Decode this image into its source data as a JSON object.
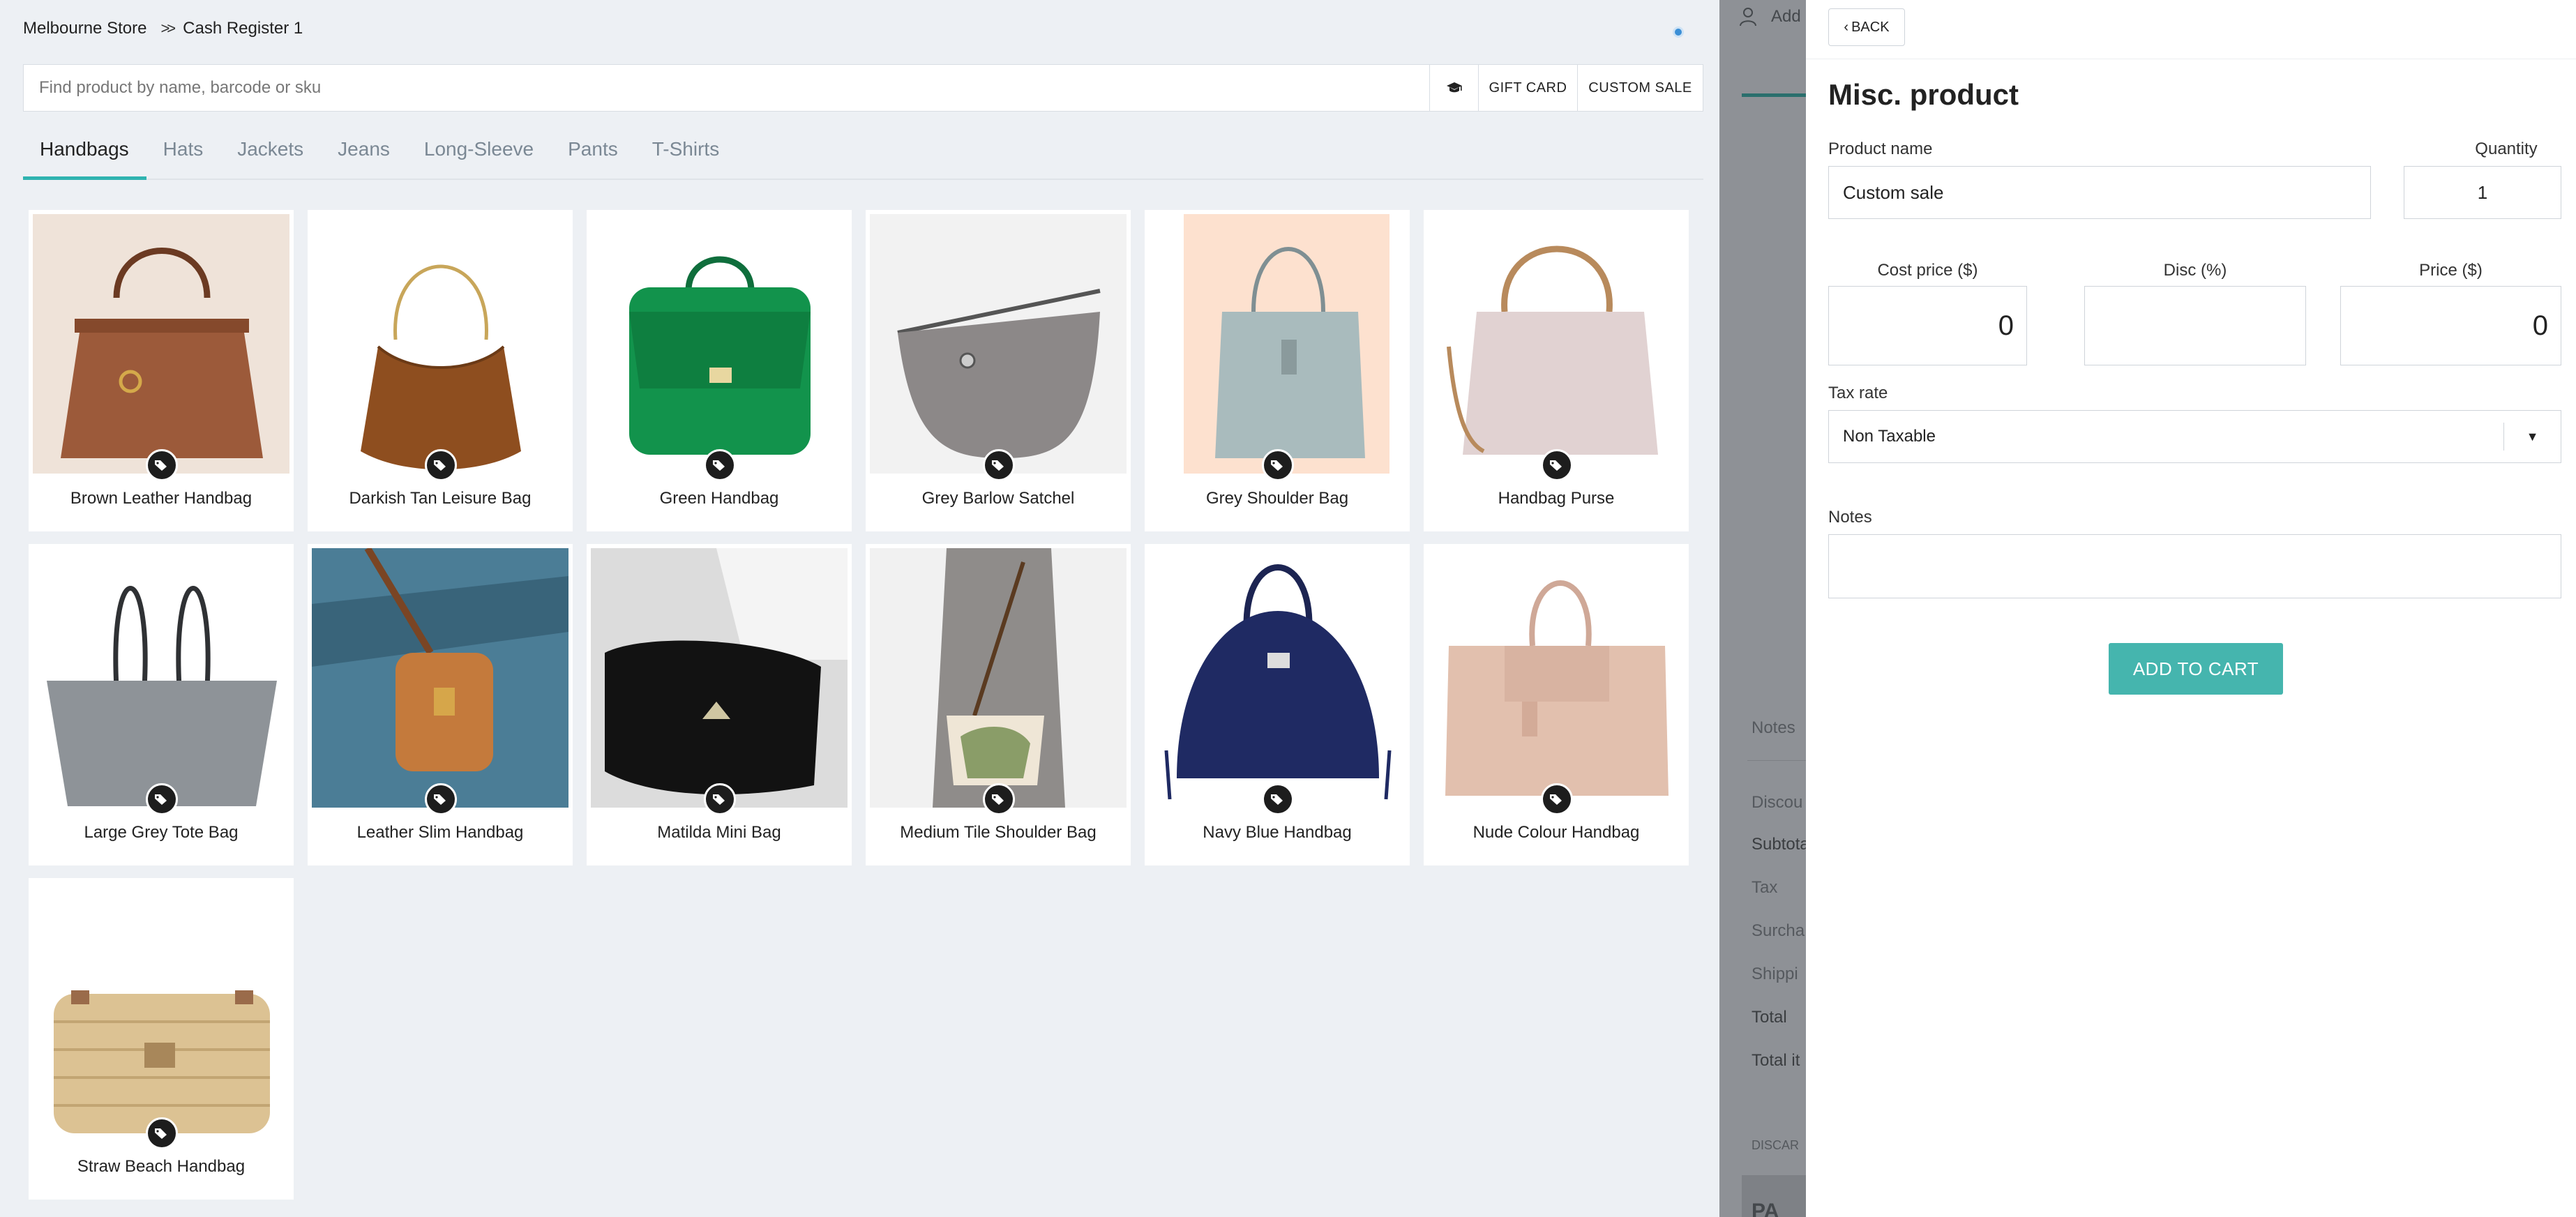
{
  "breadcrumb": {
    "store": "Melbourne Store",
    "register": "Cash Register 1"
  },
  "search": {
    "placeholder": "Find product by name, barcode or sku"
  },
  "toolbar": {
    "gift_card": "GIFT CARD",
    "custom_sale": "CUSTOM SALE"
  },
  "tabs": [
    "Handbags",
    "Hats",
    "Jackets",
    "Jeans",
    "Long-Sleeve",
    "Pants",
    "T-Shirts"
  ],
  "active_tab": "Handbags",
  "products": [
    "Brown Leather Handbag",
    "Darkish Tan Leisure Bag",
    "Green Handbag",
    "Grey Barlow Satchel",
    "Grey Shoulder Bag",
    "Handbag Purse",
    "Large Grey Tote Bag",
    "Leather Slim Handbag",
    "Matilda Mini Bag",
    "Medium Tile Shoulder Bag",
    "Navy Blue Handbag",
    "Nude Colour Handbag",
    "Straw Beach Handbag"
  ],
  "cart_behind": {
    "add_label": "Add",
    "notes": "Notes",
    "discount": "Discou",
    "subtotal": "Subtota",
    "tax": "Tax",
    "surcharge": "Surcha",
    "shipping": "Shippi",
    "total": "Total",
    "total_items": "Total it",
    "discard": "DISCAR",
    "pay": "PA"
  },
  "panel": {
    "back_label": "BACK",
    "title": "Misc. product",
    "product_name_label": "Product name",
    "product_name_value": "Custom sale",
    "quantity_label": "Quantity",
    "quantity_value": "1",
    "cost_label": "Cost price ($)",
    "cost_value": "0",
    "disc_label": "Disc (%)",
    "disc_value": "",
    "price_label": "Price ($)",
    "price_value": "0",
    "tax_label": "Tax rate",
    "tax_value": "Non Taxable",
    "notes_label": "Notes",
    "notes_value": "",
    "add_label": "ADD TO CART"
  },
  "colors": {
    "accent": "#45b5ae",
    "tab_underline": "#2fb3b0",
    "overlay": "#8e9196"
  }
}
